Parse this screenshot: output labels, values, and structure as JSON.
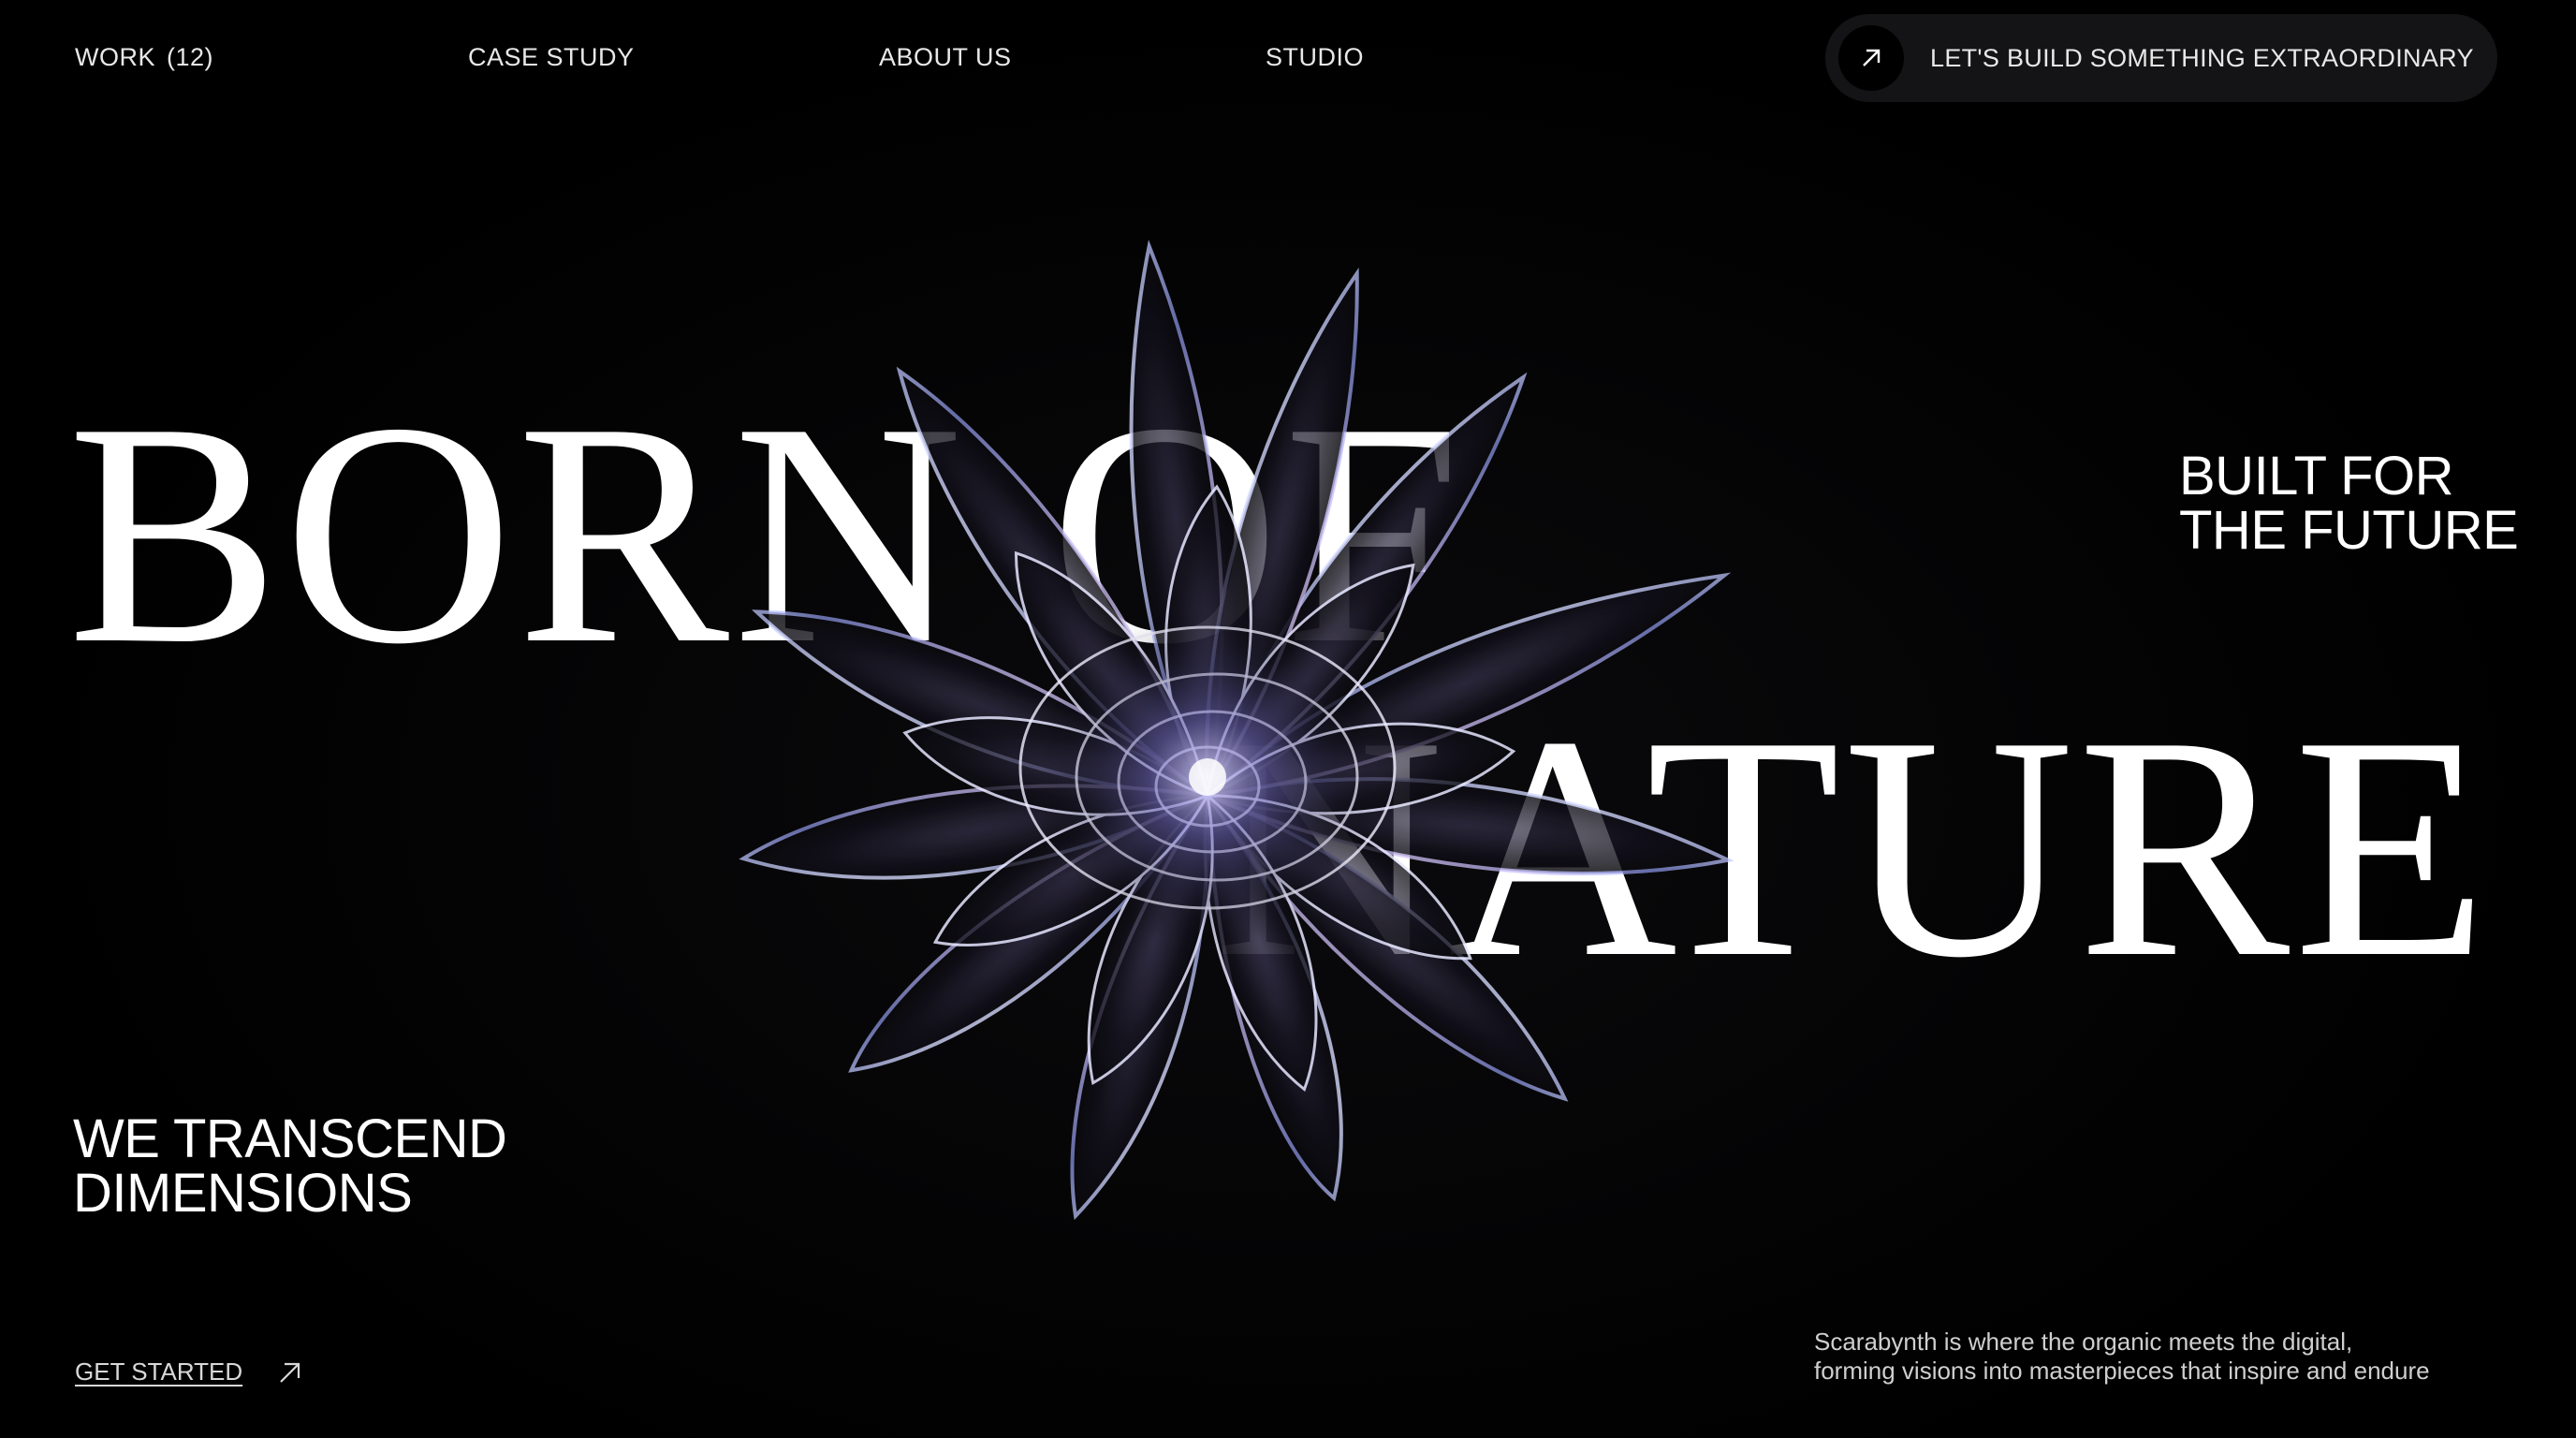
{
  "nav": {
    "work_label": "WORK",
    "work_count": "(12)",
    "case_study": "CASE STUDY",
    "about_us": "ABOUT US",
    "studio": "STUDIO"
  },
  "cta": {
    "label": "LET'S BUILD SOMETHING EXTRAORDINARY",
    "icon": "arrow-up-right-icon"
  },
  "hero": {
    "line1": "BORN OF",
    "line2": "NATURE",
    "side_top": [
      "BUILT FOR",
      "THE FUTURE"
    ],
    "side_bottom": [
      "WE TRANSCEND",
      "DIMENSIONS"
    ]
  },
  "footer": {
    "get_started": "GET STARTED",
    "tagline": [
      "Scarabynth is where the organic meets the digital,",
      "forming visions into masterpieces that inspire and endure"
    ]
  },
  "colors": {
    "background": "#000000",
    "text": "#ffffff",
    "pill": "#141416"
  }
}
